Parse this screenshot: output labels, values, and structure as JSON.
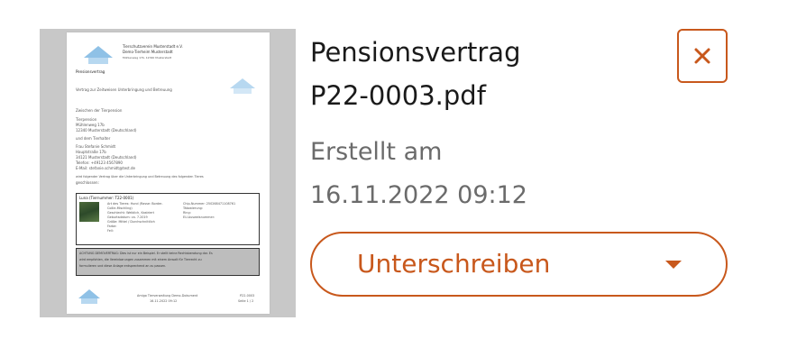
{
  "document": {
    "title_line1": "Pensionsvertrag",
    "title_line2": "P22-0003.pdf",
    "created_label": "Erstellt am",
    "created_date": "16.11.2022 09:12"
  },
  "actions": {
    "sign_label": "Unterschreiben",
    "close_icon": "close-icon",
    "dropdown_icon": "caret-down-icon"
  },
  "colors": {
    "accent": "#c8581c",
    "meta_text": "#6b6b6b",
    "thumb_bg": "#c8c8c8"
  },
  "preview": {
    "org_name": "Tierschutzverein Musterstadt e.V.",
    "org_subname": "Demo-Tierheim Musterstadt",
    "org_address": "Mühlenweg 17b, 12340 Musterstadt",
    "heading": "Pensionsvertrag",
    "subheading": "Vertrag zur Zeitweisen Unterbringung und Betreuung",
    "between": "Zwischen der Tierpension",
    "pension_name": "Tierpension",
    "pension_street": "Mühlenweg 17b",
    "pension_city": "12340 Musterstadt (Deutschland)",
    "and_owner": "und dem Tierhalter",
    "owner_name": "Frau Stefanie Schmidt",
    "owner_street": "Hauptstraße 17b",
    "owner_city": "34121 Musterstadt (Deutschland)",
    "owner_phone": "Telefon: +49123 4567890",
    "owner_email": "E-Mail: stefanie.schmidt@test.de",
    "agreement1": "wird folgender Vertrag über die Unterbringung und Betreuung des folgenden Tieres",
    "agreement2": "geschlossen:",
    "animal_name": "Luna (Tiernummer: T22-0001)",
    "animal_row1": "Art des Tieres: Hund (Rasse: Border-",
    "animal_row2": "Collie-Mischling)",
    "animal_row3": "Geschlecht: Weiblich, Kastriert",
    "animal_row4": "Geburtsdatum: ca. 7.2019",
    "animal_row5": "Größe: Mittel / Durchschnittlich",
    "animal_row6": "Farbe:",
    "animal_row7": "Fell:",
    "chip_row1": "Chip-Nummer: 250268471108761",
    "chip_row2": "Tätowierung:",
    "chip_row3": "Ring:",
    "chip_row4": "EU-Ausweisnummer:",
    "warn1": "ACHTUNG DEMOVERTRAG: Dies ist nur ein Beispiel. Er stellt keine Rechtsberatung dar. Es",
    "warn2": "wird empfohlen, die Vereinbarungen zusammen mit einem Anwalt für Tierrecht zu",
    "warn3": "formulieren und diese Anlage entsprechend an zu passen.",
    "footer1": "Amigo Tierverwaltung Demo-Dokument",
    "footer2": "16.11.2022 09:12",
    "footer_code": "P22-0003",
    "footer_page": "Seite 1 / 2"
  }
}
